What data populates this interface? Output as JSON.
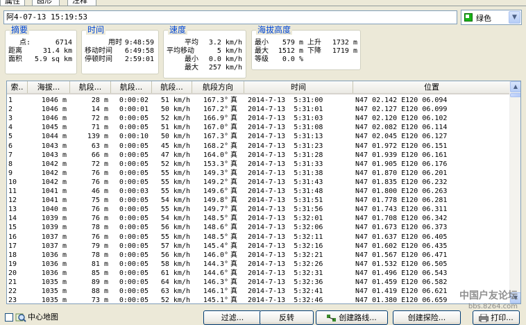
{
  "tabs": [
    {
      "label": "属性",
      "active": true
    },
    {
      "label": "图形",
      "active": false
    },
    {
      "label": "注释",
      "active": false
    }
  ],
  "track_name": "阿4-07-13 15:19:53",
  "color": {
    "label": "绿色",
    "hex": "#18b418"
  },
  "summary": {
    "title": "摘要",
    "points_label": "点:",
    "points_value": "6714",
    "distance_label": "距离",
    "distance_value": "31.4 km",
    "area_label": "面积",
    "area_value": "5.9 sq km"
  },
  "time": {
    "title": "时间",
    "elapsed_label": "用时",
    "elapsed_value": "9:48:59",
    "moving_label": "移动时间",
    "moving_value": "6:49:58",
    "stopped_label": "停顿时间",
    "stopped_value": "2:59:01"
  },
  "speed": {
    "title": "速度",
    "avg_label": "平均",
    "avg_value": "3.2 km/h",
    "avg_moving_label": "平均移动",
    "avg_moving_value": "5 km/h",
    "min_label": "最小",
    "min_value": "0.0 km/h",
    "max_label": "最大",
    "max_value": "257 km/h"
  },
  "elevation": {
    "title": "海拔高度",
    "min_label": "最小",
    "min_value": "579 m",
    "ascent_label": "上升",
    "ascent_value": "1732 m",
    "max_label": "最大",
    "max_value": "1512 m",
    "descent_label": "下降",
    "descent_value": "1719 m",
    "grade_label": "等级",
    "grade_value": "0.0 %"
  },
  "table": {
    "headers": [
      "索..",
      "海拔...",
      "航段...",
      "航段...",
      "航段...",
      "航段方向",
      "时间",
      "位置"
    ],
    "rows": [
      [
        "1",
        "1046 m",
        "28 m",
        "0:00:02",
        "51 km/h",
        "167.3°",
        "真",
        "2014-7-13  5:31:00",
        "N47 02.142 E120 06.094"
      ],
      [
        "2",
        "1046 m",
        "14 m",
        "0:00:01",
        "50 km/h",
        "167.2°",
        "真",
        "2014-7-13  5:31:01",
        "N47 02.127 E120 06.099"
      ],
      [
        "3",
        "1046 m",
        "72 m",
        "0:00:05",
        "52 km/h",
        "166.9°",
        "真",
        "2014-7-13  5:31:03",
        "N47 02.120 E120 06.102"
      ],
      [
        "4",
        "1045 m",
        "71 m",
        "0:00:05",
        "51 km/h",
        "167.0°",
        "真",
        "2014-7-13  5:31:08",
        "N47 02.082 E120 06.114"
      ],
      [
        "5",
        "1044 m",
        "139 m",
        "0:00:10",
        "50 km/h",
        "167.3°",
        "真",
        "2014-7-13  5:31:13",
        "N47 02.045 E120 06.127"
      ],
      [
        "6",
        "1043 m",
        "63 m",
        "0:00:05",
        "45 km/h",
        "168.2°",
        "真",
        "2014-7-13  5:31:23",
        "N47 01.972 E120 06.151"
      ],
      [
        "7",
        "1043 m",
        "66 m",
        "0:00:05",
        "47 km/h",
        "164.0°",
        "真",
        "2014-7-13  5:31:28",
        "N47 01.939 E120 06.161"
      ],
      [
        "8",
        "1042 m",
        "72 m",
        "0:00:05",
        "52 km/h",
        "153.3°",
        "真",
        "2014-7-13  5:31:33",
        "N47 01.905 E120 06.176"
      ],
      [
        "9",
        "1042 m",
        "76 m",
        "0:00:05",
        "55 km/h",
        "149.3°",
        "真",
        "2014-7-13  5:31:38",
        "N47 01.870 E120 06.201"
      ],
      [
        "10",
        "1042 m",
        "76 m",
        "0:00:05",
        "55 km/h",
        "149.2°",
        "真",
        "2014-7-13  5:31:43",
        "N47 01.835 E120 06.232"
      ],
      [
        "11",
        "1041 m",
        "46 m",
        "0:00:03",
        "55 km/h",
        "149.6°",
        "真",
        "2014-7-13  5:31:48",
        "N47 01.800 E120 06.263"
      ],
      [
        "12",
        "1041 m",
        "75 m",
        "0:00:05",
        "54 km/h",
        "149.8°",
        "真",
        "2014-7-13  5:31:51",
        "N47 01.778 E120 06.281"
      ],
      [
        "13",
        "1040 m",
        "76 m",
        "0:00:05",
        "55 km/h",
        "149.7°",
        "真",
        "2014-7-13  5:31:56",
        "N47 01.743 E120 06.311"
      ],
      [
        "14",
        "1039 m",
        "76 m",
        "0:00:05",
        "54 km/h",
        "148.5°",
        "真",
        "2014-7-13  5:32:01",
        "N47 01.708 E120 06.342"
      ],
      [
        "15",
        "1039 m",
        "78 m",
        "0:00:05",
        "56 km/h",
        "148.6°",
        "真",
        "2014-7-13  5:32:06",
        "N47 01.673 E120 06.373"
      ],
      [
        "16",
        "1037 m",
        "76 m",
        "0:00:05",
        "55 km/h",
        "148.5°",
        "真",
        "2014-7-13  5:32:11",
        "N47 01.637 E120 06.405"
      ],
      [
        "17",
        "1037 m",
        "79 m",
        "0:00:05",
        "57 km/h",
        "145.4°",
        "真",
        "2014-7-13  5:32:16",
        "N47 01.602 E120 06.435"
      ],
      [
        "18",
        "1036 m",
        "78 m",
        "0:00:05",
        "56 km/h",
        "146.0°",
        "真",
        "2014-7-13  5:32:21",
        "N47 01.567 E120 06.471"
      ],
      [
        "19",
        "1036 m",
        "81 m",
        "0:00:05",
        "58 km/h",
        "144.3°",
        "真",
        "2014-7-13  5:32:26",
        "N47 01.532 E120 06.505"
      ],
      [
        "20",
        "1036 m",
        "85 m",
        "0:00:05",
        "61 km/h",
        "144.6°",
        "真",
        "2014-7-13  5:32:31",
        "N47 01.496 E120 06.543"
      ],
      [
        "21",
        "1035 m",
        "89 m",
        "0:00:05",
        "64 km/h",
        "146.3°",
        "真",
        "2014-7-13  5:32:36",
        "N47 01.459 E120 06.582"
      ],
      [
        "22",
        "1035 m",
        "88 m",
        "0:00:05",
        "63 km/h",
        "146.1°",
        "真",
        "2014-7-13  5:32:41",
        "N47 01.419 E120 06.621"
      ],
      [
        "23",
        "1035 m",
        "73 m",
        "0:00:05",
        "52 km/h",
        "145.1°",
        "真",
        "2014-7-13  5:32:46",
        "N47 01.380 E120 06.659"
      ]
    ]
  },
  "bottom": {
    "center_map_label": "中心地图",
    "filter_label": "过滤...",
    "reverse_label": "反转",
    "create_route_label": "创建路线...",
    "create_search_label": "创建探险...",
    "print_label": "打印..."
  },
  "watermark": {
    "line1": "中国户友论坛",
    "line2": "bbs.8264.com"
  }
}
